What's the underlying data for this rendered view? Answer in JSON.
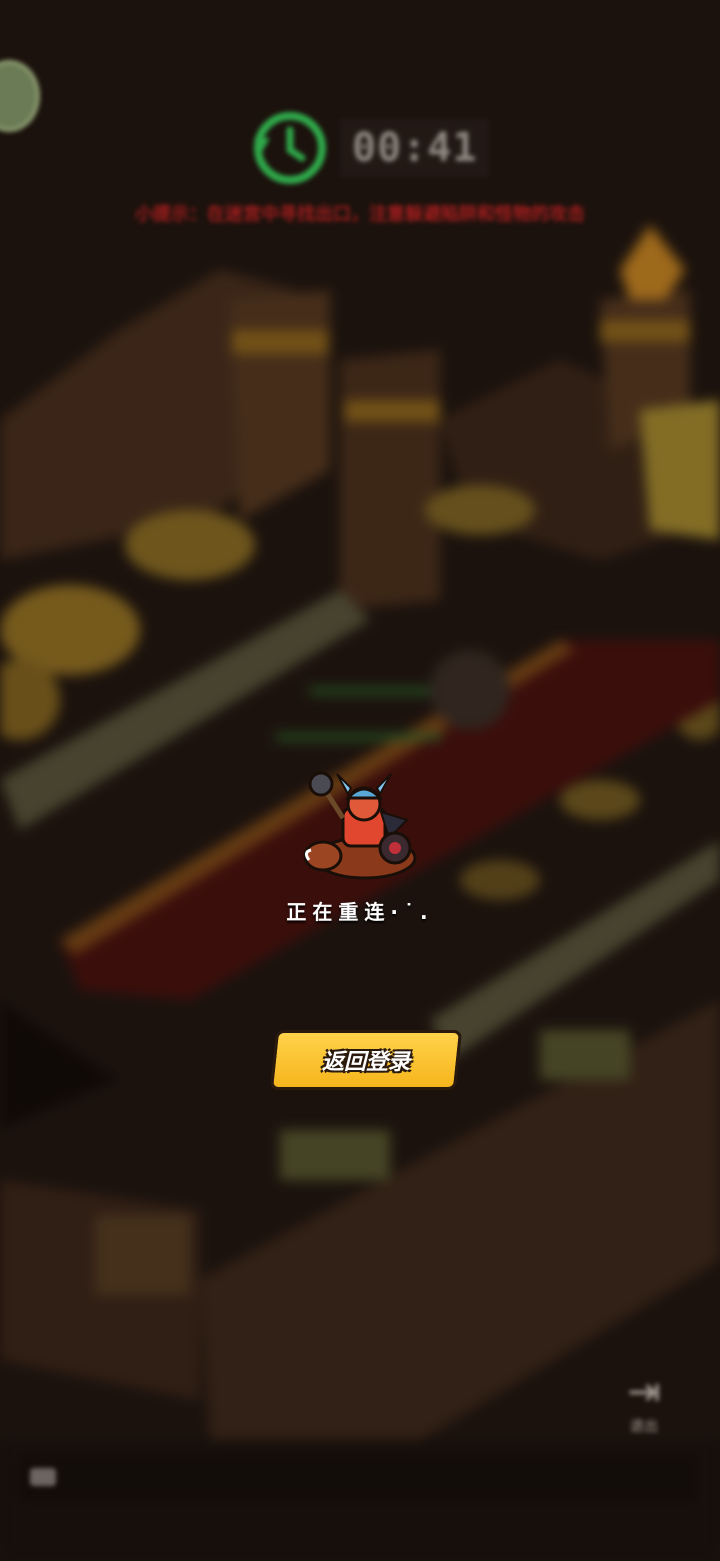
{
  "hud": {
    "timer": "00:41",
    "warning": "小提示：在迷宫中寻找出口，注意躲避陷阱和怪物的攻击",
    "exit_label": "退出"
  },
  "reconnect": {
    "status": "正在重连·˙.",
    "return_button": "返回登录"
  },
  "colors": {
    "button": "#f6c22f",
    "timer_ring": "#2fa84a",
    "warning": "#a31e1e"
  },
  "icons": {
    "timer": "clock-icon",
    "exit": "exit-door-icon",
    "chat": "chat-icon",
    "avatar": "leaf-avatar-icon"
  }
}
